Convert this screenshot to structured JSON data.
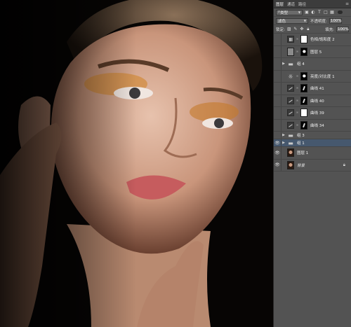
{
  "panel": {
    "tabs": [
      "图层",
      "通道",
      "路径"
    ],
    "active_tab": 0,
    "filter": {
      "label": "类型",
      "options_visible": [
        "类型"
      ]
    },
    "blend": {
      "mode": "滤色",
      "opacity_label": "不透明度:",
      "opacity": "100%"
    },
    "lock": {
      "label": "锁定:",
      "fill_label": "填充:",
      "fill": "100%"
    },
    "layers": [
      {
        "name": "色相/饱和度 2",
        "type": "hue",
        "visible": false,
        "mask": "white",
        "selected": false
      },
      {
        "name": "图层 5",
        "type": "pixel",
        "visible": false,
        "thumb": "gray",
        "mask": "spot",
        "selected": false
      },
      {
        "name": "组 4",
        "type": "group",
        "visible": false,
        "selected": false
      },
      {
        "name": "亮度/对比度 1",
        "type": "brightness",
        "visible": false,
        "mask": "spot",
        "selected": false
      },
      {
        "name": "曲线 41",
        "type": "curve",
        "visible": false,
        "mask": "stroke",
        "selected": false
      },
      {
        "name": "曲线 40",
        "type": "curve",
        "visible": false,
        "mask": "stroke",
        "selected": false
      },
      {
        "name": "曲线 39",
        "type": "curve",
        "visible": false,
        "mask": "white",
        "selected": false
      },
      {
        "name": "曲线 34",
        "type": "curve",
        "visible": false,
        "mask": "stroke",
        "selected": false
      },
      {
        "name": "组 3",
        "type": "group",
        "visible": false,
        "selected": false
      },
      {
        "name": "组 1",
        "type": "group",
        "visible": true,
        "selected": true
      },
      {
        "name": "图层 1",
        "type": "pixel",
        "visible": true,
        "thumb": "face",
        "selected": false
      },
      {
        "name": "背景",
        "type": "background",
        "visible": true,
        "thumb": "face",
        "locked": true,
        "selected": false
      }
    ]
  }
}
